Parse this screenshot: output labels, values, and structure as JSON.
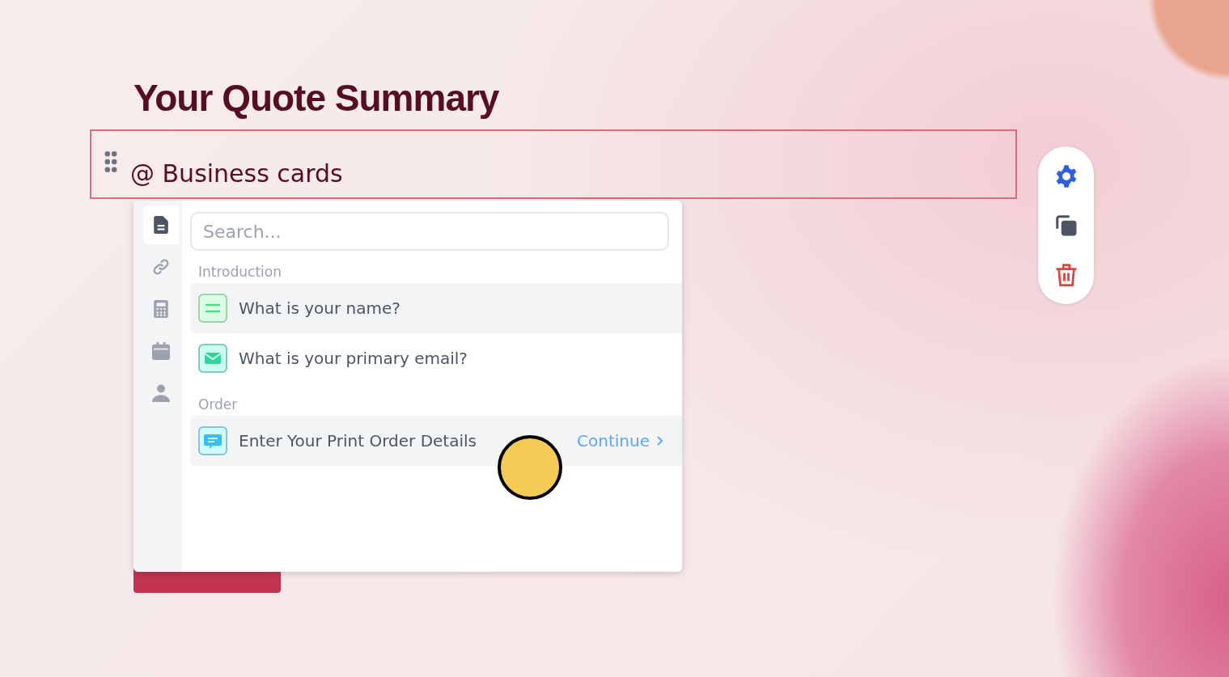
{
  "title": "Your Quote Summary",
  "block": {
    "text": "@ Business cards",
    "focused": true
  },
  "popup": {
    "tabs": [
      {
        "kind": "document",
        "selected": true
      },
      {
        "kind": "link",
        "selected": false
      },
      {
        "kind": "calculator",
        "selected": false
      },
      {
        "kind": "calendar",
        "selected": false
      },
      {
        "kind": "person",
        "selected": false
      }
    ],
    "search": {
      "placeholder": "Search..."
    },
    "groups": [
      {
        "heading": "Introduction",
        "items": [
          {
            "kind": "text",
            "label": "What is your name?",
            "highlighted": true
          },
          {
            "kind": "email",
            "label": "What is your primary email?",
            "highlighted": false
          }
        ]
      },
      {
        "heading": "Order",
        "items": [
          {
            "kind": "message",
            "label": "Enter Your Print Order Details",
            "highlighted": true,
            "action": "Continue"
          }
        ]
      }
    ]
  },
  "toolbar": [
    {
      "kind": "settings"
    },
    {
      "kind": "duplicate"
    },
    {
      "kind": "delete"
    }
  ]
}
